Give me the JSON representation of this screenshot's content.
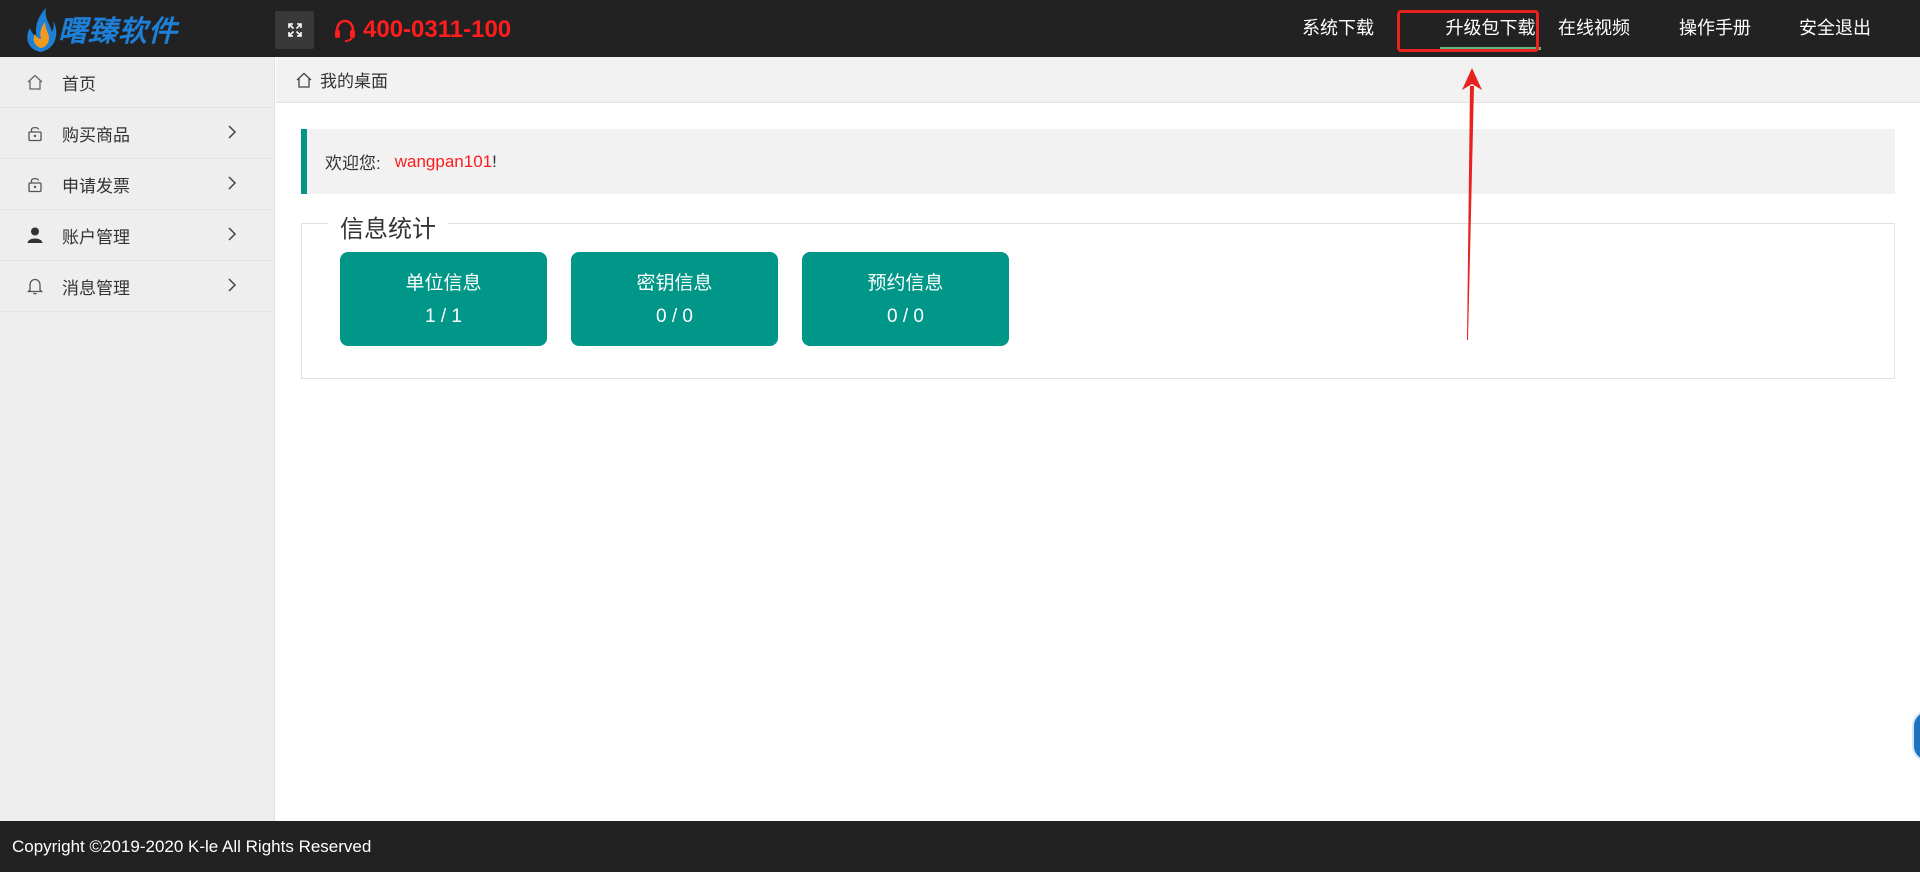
{
  "header": {
    "logo_text": "曙臻软件",
    "phone": "400-0311-100",
    "nav": [
      "系统下载",
      "升级包下载",
      "在线视频",
      "操作手册",
      "安全退出"
    ]
  },
  "sidebar": {
    "items": [
      {
        "label": "首页",
        "icon": "home-outline-icon",
        "has_submenu": false
      },
      {
        "label": "购买商品",
        "icon": "lock-icon",
        "has_submenu": true
      },
      {
        "label": "申请发票",
        "icon": "lock-icon",
        "has_submenu": true
      },
      {
        "label": "账户管理",
        "icon": "user-icon",
        "has_submenu": true
      },
      {
        "label": "消息管理",
        "icon": "bell-icon",
        "has_submenu": true
      }
    ]
  },
  "breadcrumb": {
    "label": "我的桌面"
  },
  "welcome": {
    "prefix": "欢迎您:",
    "username": "wangpan101",
    "suffix": "!"
  },
  "stats": {
    "title": "信息统计",
    "cards": [
      {
        "title": "单位信息",
        "value": "1 / 1"
      },
      {
        "title": "密钥信息",
        "value": "0 / 0"
      },
      {
        "title": "预约信息",
        "value": "0 / 0"
      }
    ]
  },
  "footer": {
    "copyright": "Copyright ©2019-2020 K-le All Rights Reserved"
  },
  "colors": {
    "header_bg": "#222222",
    "accent_teal": "#009688",
    "highlight_red": "#e8231f",
    "phone_red": "#ff1c1c",
    "sidebar_bg": "#eeeeee"
  }
}
